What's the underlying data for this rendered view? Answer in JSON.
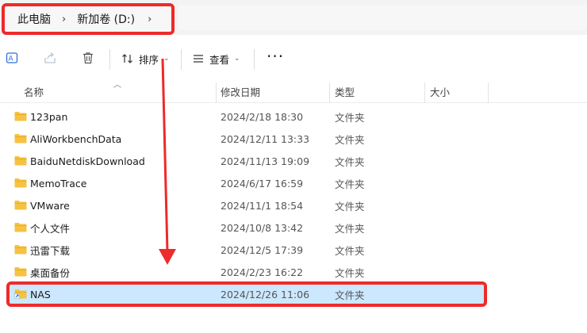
{
  "breadcrumb": {
    "items": [
      "此电脑",
      "新加卷 (D:)"
    ],
    "separator": "›"
  },
  "toolbar": {
    "sort_label": "排序",
    "view_label": "查看",
    "more_label": "···"
  },
  "columns": {
    "name": "名称",
    "modified": "修改日期",
    "type": "类型",
    "size": "大小"
  },
  "files": [
    {
      "name": "123pan",
      "modified": "2024/2/18 18:30",
      "type": "文件夹"
    },
    {
      "name": "AliWorkbenchData",
      "modified": "2024/12/11 13:33",
      "type": "文件夹"
    },
    {
      "name": "BaiduNetdiskDownload",
      "modified": "2024/11/13 19:09",
      "type": "文件夹"
    },
    {
      "name": "MemoTrace",
      "modified": "2024/6/17 16:59",
      "type": "文件夹"
    },
    {
      "name": "VMware",
      "modified": "2024/11/1 18:54",
      "type": "文件夹"
    },
    {
      "name": "个人文件",
      "modified": "2024/10/8 13:42",
      "type": "文件夹"
    },
    {
      "name": "迅雷下载",
      "modified": "2024/12/5 17:39",
      "type": "文件夹"
    },
    {
      "name": "桌面备份",
      "modified": "2024/2/23 16:22",
      "type": "文件夹"
    },
    {
      "name": "NAS",
      "modified": "2024/12/26 11:06",
      "type": "文件夹",
      "selected": true,
      "shortcut": true
    }
  ],
  "colors": {
    "annotation": "#ee2a2a",
    "selection": "#cce8ff",
    "folder": "#f5c242"
  }
}
